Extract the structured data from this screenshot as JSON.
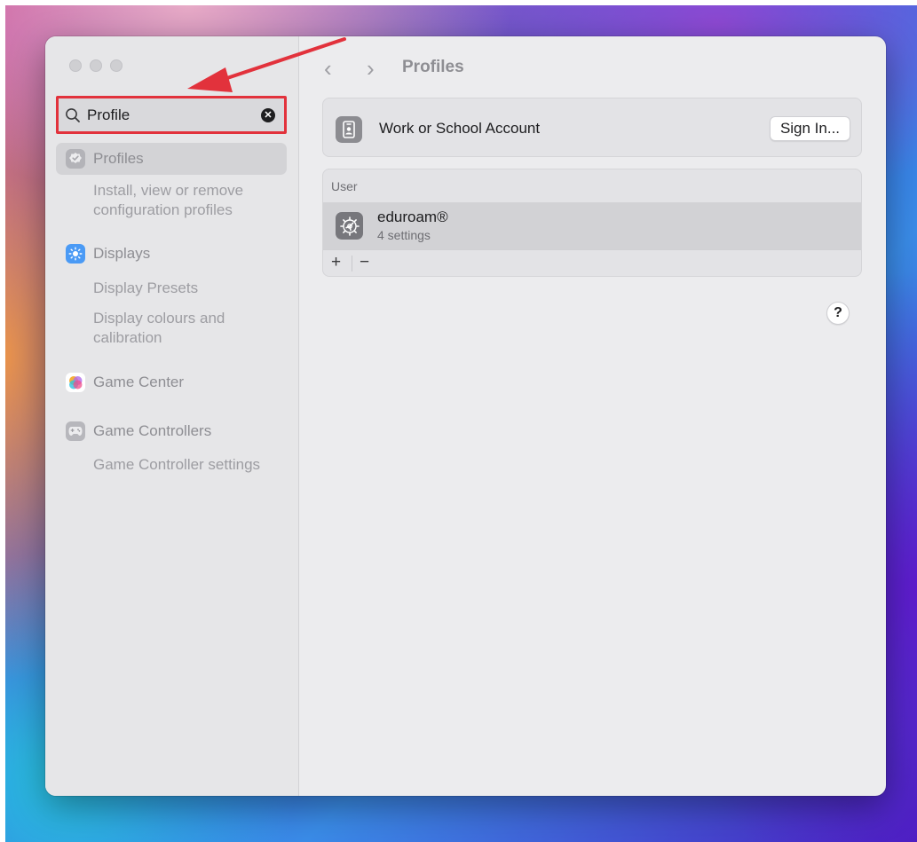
{
  "search": {
    "value": "Profile"
  },
  "sidebar": {
    "items": [
      {
        "label": "Profiles",
        "sub": "Install, view or remove configuration profiles"
      },
      {
        "label": "Displays",
        "sub1": "Display Presets",
        "sub2": "Display colours and calibration"
      },
      {
        "label": "Game Center"
      },
      {
        "label": "Game Controllers",
        "sub": "Game Controller settings"
      }
    ]
  },
  "header": {
    "title": "Profiles"
  },
  "account": {
    "label": "Work or School Account",
    "button": "Sign In..."
  },
  "profiles_list": {
    "header": "User",
    "rows": [
      {
        "name": "eduroam®",
        "detail": "4 settings"
      }
    ],
    "add": "+",
    "remove": "−"
  },
  "help": {
    "label": "?"
  },
  "colors": {
    "annotation": "#e2323c",
    "displays_icon": "#4a9af5"
  }
}
